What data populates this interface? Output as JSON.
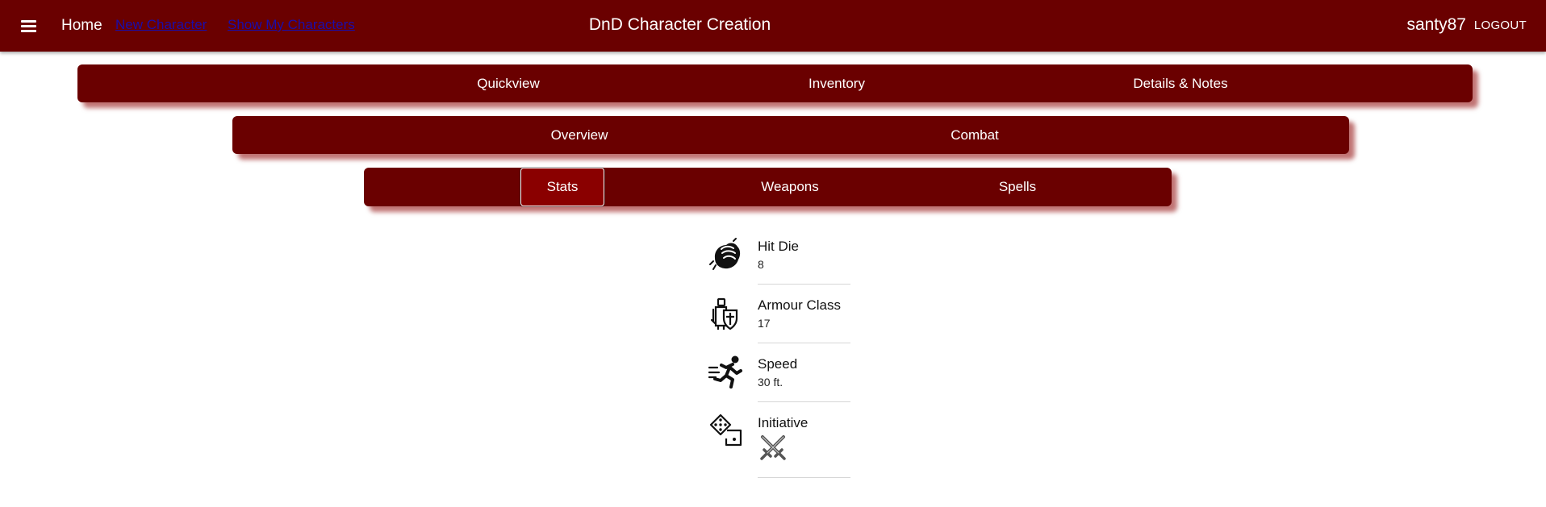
{
  "appbar": {
    "home_label": "Home",
    "links": [
      "New Character",
      "Show My Characters"
    ],
    "title": "DnD Character Creation",
    "username": "santy87",
    "logout_label": "LOGOUT"
  },
  "tabs_primary": [
    "Quickview",
    "Inventory",
    "Details & Notes"
  ],
  "tabs_secondary": [
    "Overview",
    "Combat"
  ],
  "tabs_tertiary": [
    "Stats",
    "Weapons",
    "Spells"
  ],
  "active_tab": "Stats",
  "stats": [
    {
      "label": "Hit Die",
      "value": "8",
      "icon": "fist-icon"
    },
    {
      "label": "Armour Class",
      "value": "17",
      "icon": "knight-shield-icon"
    },
    {
      "label": "Speed",
      "value": "30 ft.",
      "icon": "running-man-icon"
    },
    {
      "label": "Initiative",
      "value": "",
      "icon": "dice-icon",
      "value_icon": "crossed-swords-icon"
    }
  ],
  "colors": {
    "primary": "#6a0000",
    "active_tab": "#8a0000",
    "link": "#1a0dab"
  }
}
